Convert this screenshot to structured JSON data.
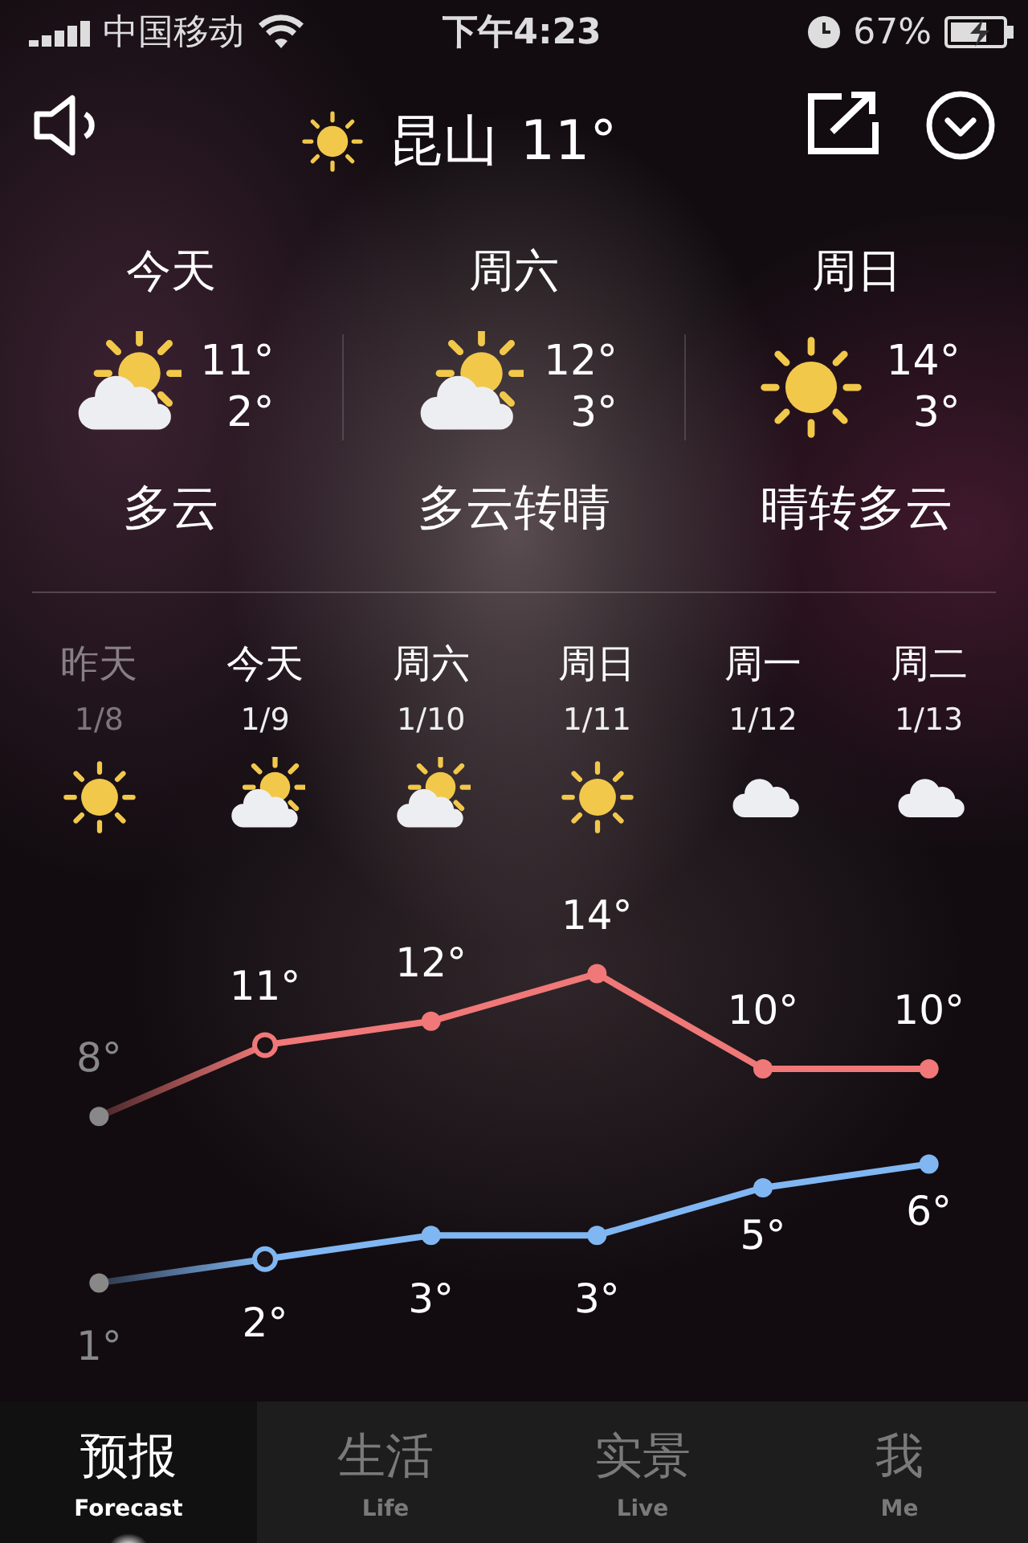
{
  "status_bar": {
    "carrier": "中国移动",
    "time": "下午4:23",
    "battery": "67%"
  },
  "header": {
    "kind": "sunny",
    "city": "昆山",
    "temperature": "11°"
  },
  "summary": [
    {
      "label": "今天",
      "kind": "partly_cloudy",
      "high": "11°",
      "low": "2°",
      "description": "多云"
    },
    {
      "label": "周六",
      "kind": "partly_cloudy",
      "high": "12°",
      "low": "3°",
      "description": "多云转晴"
    },
    {
      "label": "周日",
      "kind": "sunny",
      "high": "14°",
      "low": "3°",
      "description": "晴转多云"
    }
  ],
  "forecast": [
    {
      "label": "昨天",
      "date": "1/8",
      "kind": "sunny",
      "past": true,
      "selected": false
    },
    {
      "label": "今天",
      "date": "1/9",
      "kind": "partly_cloudy",
      "past": false,
      "selected": true
    },
    {
      "label": "周六",
      "date": "1/10",
      "kind": "partly_cloudy",
      "past": false,
      "selected": false
    },
    {
      "label": "周日",
      "date": "1/11",
      "kind": "sunny",
      "past": false,
      "selected": false
    },
    {
      "label": "周一",
      "date": "1/12",
      "kind": "cloudy",
      "past": false,
      "selected": false
    },
    {
      "label": "周二",
      "date": "1/13",
      "kind": "cloudy",
      "past": false,
      "selected": false
    }
  ],
  "chart_data": {
    "type": "line",
    "data_labels": true,
    "series": [
      {
        "color": "#f07878",
        "marker": "circle",
        "values": [
          8,
          11,
          12,
          14,
          10,
          10
        ],
        "value_labels": [
          "8°",
          "11°",
          "12°",
          "14°",
          "10°",
          "10°"
        ]
      },
      {
        "color": "#80b6f2",
        "marker": "circle",
        "values": [
          1,
          2,
          3,
          3,
          5,
          6
        ],
        "value_labels": [
          "1°",
          "2°",
          "3°",
          "3°",
          "5°",
          "6°"
        ]
      }
    ]
  },
  "tabs": [
    {
      "label": "预报",
      "sublabel": "Forecast",
      "selected": true
    },
    {
      "label": "生活",
      "sublabel": "Life",
      "selected": false
    },
    {
      "label": "实景",
      "sublabel": "Live",
      "selected": false
    },
    {
      "label": "我",
      "sublabel": "Me",
      "selected": false
    }
  ]
}
